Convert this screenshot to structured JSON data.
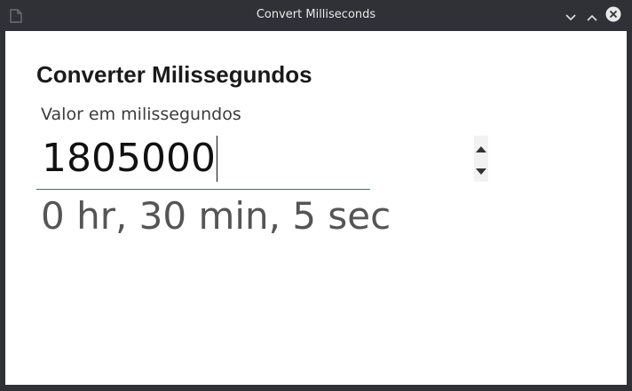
{
  "window": {
    "title": "Convert Milliseconds",
    "icon": "document-icon",
    "controls": [
      "minimize-icon",
      "maximize-icon",
      "close-icon"
    ]
  },
  "main": {
    "heading": "Converter Milissegundos",
    "field_label": "Valor em milissegundos",
    "input_value": "1805000",
    "result": "0 hr, 30 min, 5 sec"
  },
  "colors": {
    "titlebar": "#2f3136",
    "accent_underline": "#2e8b2e",
    "result_text": "#555555"
  }
}
